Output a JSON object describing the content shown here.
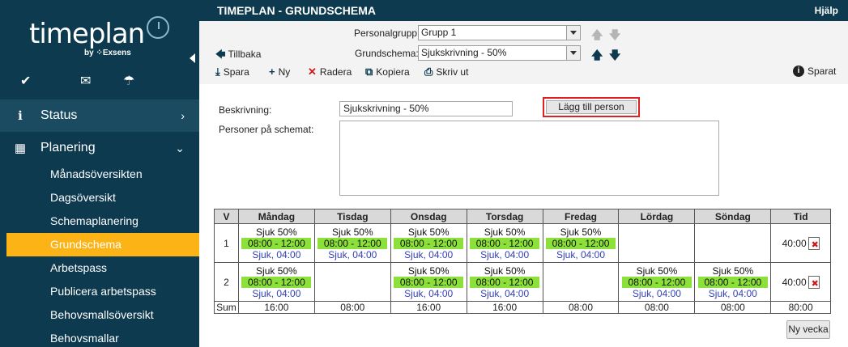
{
  "sidebar": {
    "logo_text": "timeplan",
    "logo_by": "by ⁘Exsens",
    "quick_icons": [
      "check-icon",
      "mail-icon",
      "umbrella-icon"
    ],
    "nav": [
      {
        "label": "Status",
        "icon": "info-icon"
      },
      {
        "label": "Planering",
        "icon": "calendar-icon"
      }
    ],
    "sub_items": [
      "Månadsöversikten",
      "Dagsöversikt",
      "Schemaplanering",
      "Grundschema",
      "Arbetspass",
      "Publicera arbetspass",
      "Behovsmallsöversikt",
      "Behovsmallar"
    ],
    "active_sub": "Grundschema"
  },
  "topbar": {
    "title": "TIMEPLAN - GRUNDSCHEMA",
    "help": "Hjälp"
  },
  "toolbar": {
    "personalgrupp_label": "Personalgrupp:",
    "personalgrupp_value": "Grupp 1",
    "back_label": "Tillbaka",
    "grundschema_label": "Grundschema:",
    "grundschema_value": "Sjukskrivning - 50%",
    "save_label": "Spara",
    "new_label": "Ny",
    "delete_label": "Radera",
    "copy_label": "Kopiera",
    "print_label": "Skriv ut",
    "saved_label": "Sparat"
  },
  "form": {
    "description_label": "Beskrivning:",
    "description_value": "Sjukskrivning - 50%",
    "add_person_label": "Lägg till person",
    "persons_label": "Personer på schemat:"
  },
  "schedule": {
    "headers": [
      "V",
      "Måndag",
      "Tisdag",
      "Onsdag",
      "Torsdag",
      "Fredag",
      "Lördag",
      "Söndag",
      "Tid"
    ],
    "weeks": [
      {
        "week": "1",
        "days": [
          {
            "name": "Sjuk 50%",
            "time": "08:00 - 12:00",
            "sub": "Sjuk, 04:00"
          },
          {
            "name": "Sjuk 50%",
            "time": "08:00 - 12:00",
            "sub": "Sjuk, 04:00"
          },
          {
            "name": "Sjuk 50%",
            "time": "08:00 - 12:00",
            "sub": "Sjuk, 04:00"
          },
          {
            "name": "Sjuk 50%",
            "time": "08:00 - 12:00",
            "sub": "Sjuk, 04:00"
          },
          {
            "name": "Sjuk 50%",
            "time": "08:00 - 12:00",
            "sub": "Sjuk, 04:00"
          },
          null,
          null
        ],
        "tid": "40:00"
      },
      {
        "week": "2",
        "days": [
          {
            "name": "Sjuk 50%",
            "time": "08:00 - 12:00",
            "sub": "Sjuk, 04:00"
          },
          null,
          {
            "name": "Sjuk 50%",
            "time": "08:00 - 12:00",
            "sub": "Sjuk, 04:00"
          },
          {
            "name": "Sjuk 50%",
            "time": "08:00 - 12:00",
            "sub": "Sjuk, 04:00"
          },
          null,
          {
            "name": "Sjuk 50%",
            "time": "08:00 - 12:00",
            "sub": "Sjuk, 04:00"
          },
          {
            "name": "Sjuk 50%",
            "time": "08:00 - 12:00",
            "sub": "Sjuk, 04:00"
          }
        ],
        "tid": "40:00"
      }
    ],
    "sum_label": "Sum",
    "sums": [
      "16:00",
      "08:00",
      "16:00",
      "16:00",
      "08:00",
      "08:00",
      "08:00",
      "80:00"
    ]
  },
  "new_week_label": "Ny vecka",
  "colors": {
    "sidebar_bg": "#0d3a4e",
    "active_item": "#fbb316",
    "shift_green": "#8be13a",
    "sub_text": "#3340b8",
    "highlight_border": "#e02020"
  }
}
